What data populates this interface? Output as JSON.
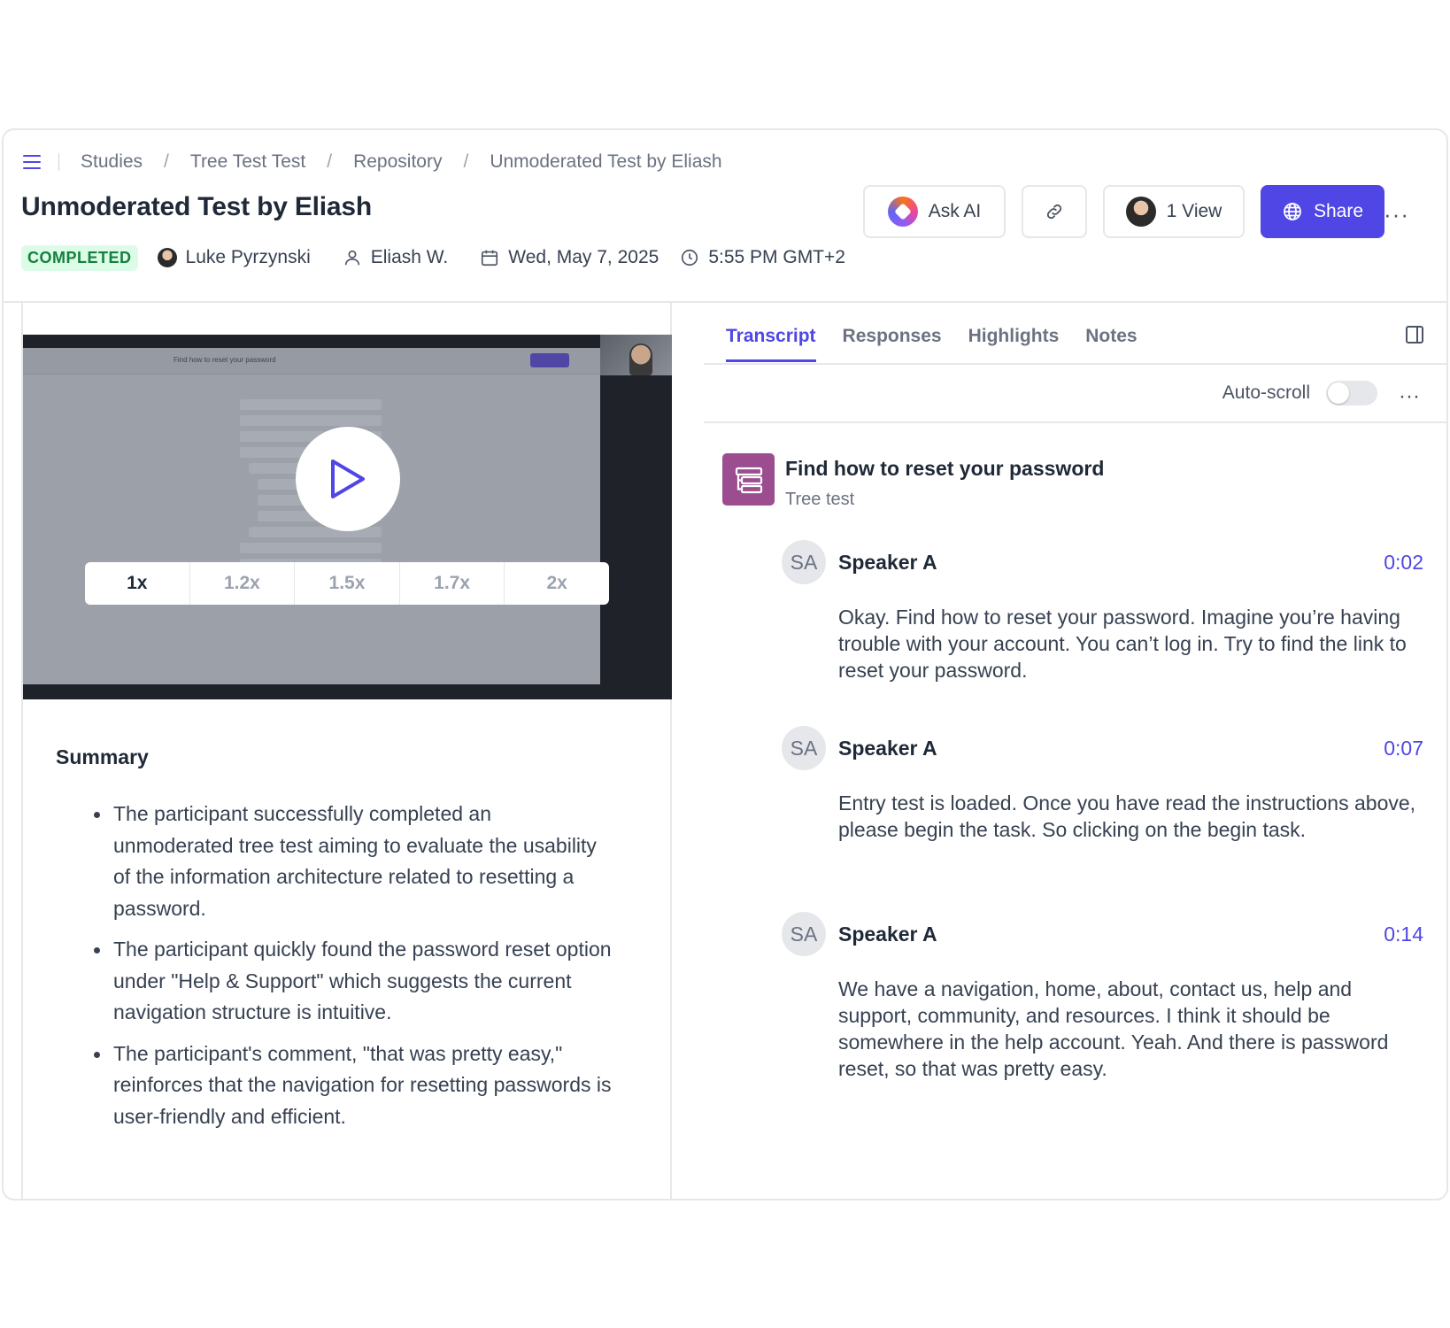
{
  "breadcrumb": [
    "Studies",
    "Tree Test Test",
    "Repository",
    "Unmoderated Test by Eliash"
  ],
  "page_title": "Unmoderated Test by Eliash",
  "actions": {
    "ask_ai": "Ask AI",
    "views": "1 View",
    "share": "Share",
    "more": "···"
  },
  "meta": {
    "status": "COMPLETED",
    "author": "Luke Pyrzynski",
    "participant": "Eliash W.",
    "date": "Wed, May 7, 2025",
    "time": "5:55 PM GMT+2"
  },
  "video": {
    "screen_title": "Find how to reset your password",
    "speeds": [
      "1x",
      "1.2x",
      "1.5x",
      "1.7x",
      "2x"
    ],
    "selected_speed": "1x"
  },
  "summary": {
    "title": "Summary",
    "bullets": [
      "The participant successfully completed an unmoderated tree test aiming to evaluate the usability of the information architecture related to resetting a password.",
      "The participant quickly found the password reset option under \"Help & Support\" which suggests the current navigation structure is intuitive.",
      "The participant's comment, \"that was pretty easy,\" reinforces that the navigation for resetting passwords is user-friendly and efficient."
    ]
  },
  "tabs": [
    "Transcript",
    "Responses",
    "Highlights",
    "Notes"
  ],
  "active_tab": "Transcript",
  "autoscroll": {
    "label": "Auto-scroll",
    "enabled": false
  },
  "task": {
    "title": "Find how to reset your password",
    "type": "Tree test"
  },
  "transcript": [
    {
      "initials": "SA",
      "speaker": "Speaker A",
      "time": "0:02",
      "text": "Okay. Find how to reset your password. Imagine you’re having trouble with your account. You can’t log in. Try to find the link to reset your password."
    },
    {
      "initials": "SA",
      "speaker": "Speaker A",
      "time": "0:07",
      "text": "Entry test is loaded. Once you have read the instructions above, please begin the task. So clicking on the begin task."
    },
    {
      "initials": "SA",
      "speaker": "Speaker A",
      "time": "0:14",
      "text": "We have a navigation, home, about, contact us, help and support, community, and resources. I think it should be somewhere in the help account. Yeah. And there is password reset, so that was pretty easy."
    }
  ],
  "colors": {
    "accent": "#4f46e5",
    "status_bg": "#dcfce7",
    "status_text": "#15803d",
    "task_icon": "#9b4d8f"
  }
}
